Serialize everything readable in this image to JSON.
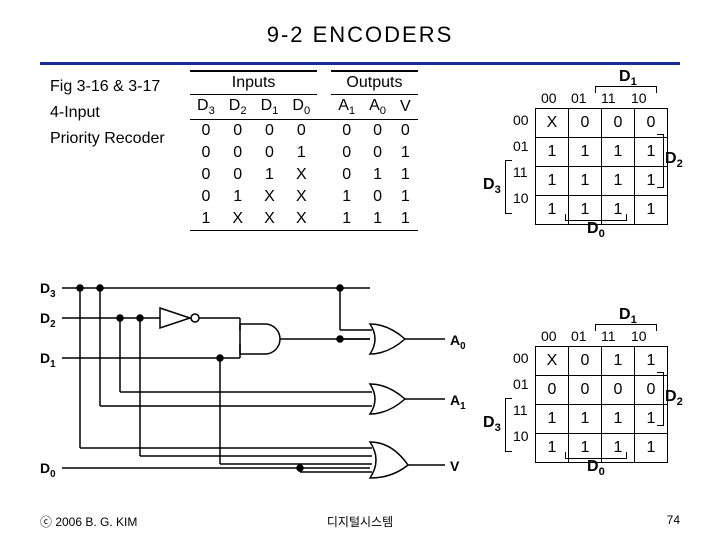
{
  "title": "9-2  ENCODERS",
  "caption": {
    "line1": "Fig 3-16 & 3-17",
    "line2": "4-Input",
    "line3": "Priority Recoder"
  },
  "truth_table": {
    "group_in": "Inputs",
    "group_out": "Outputs",
    "cols_in": [
      "D3",
      "D2",
      "D1",
      "D0"
    ],
    "cols_out": [
      "A1",
      "A0",
      "V"
    ],
    "col_d3": "D",
    "col_d3s": "3",
    "col_d2": "D",
    "col_d2s": "2",
    "col_d1": "D",
    "col_d1s": "1",
    "col_d0": "D",
    "col_d0s": "0",
    "col_a1": "A",
    "col_a1s": "1",
    "col_a0": "A",
    "col_a0s": "0",
    "col_v": "V",
    "rows": [
      {
        "d3": "0",
        "d2": "0",
        "d1": "0",
        "d0": "0",
        "a1": "0",
        "a0": "0",
        "v": "0"
      },
      {
        "d3": "0",
        "d2": "0",
        "d1": "0",
        "d0": "1",
        "a1": "0",
        "a0": "0",
        "v": "1"
      },
      {
        "d3": "0",
        "d2": "0",
        "d1": "1",
        "d0": "X",
        "a1": "0",
        "a0": "1",
        "v": "1"
      },
      {
        "d3": "0",
        "d2": "1",
        "d1": "X",
        "d0": "X",
        "a1": "1",
        "a0": "0",
        "v": "1"
      },
      {
        "d3": "1",
        "d2": "X",
        "d1": "X",
        "d0": "X",
        "a1": "1",
        "a0": "1",
        "v": "1"
      }
    ]
  },
  "kmap_top": {
    "col_hdr": [
      "00",
      "01",
      "11",
      "10"
    ],
    "row_hdr": [
      "00",
      "01",
      "11",
      "10"
    ],
    "label_top": "D",
    "label_top_s": "1",
    "label_right": "D",
    "label_right_s": "2",
    "label_bot": "D",
    "label_bot_s": "0",
    "label_left": "D",
    "label_left_s": "3",
    "cells": [
      [
        "X",
        "0",
        "0",
        "0"
      ],
      [
        "1",
        "1",
        "1",
        "1"
      ],
      [
        "1",
        "1",
        "1",
        "1"
      ],
      [
        "1",
        "1",
        "1",
        "1"
      ]
    ]
  },
  "kmap_bot": {
    "col_hdr": [
      "00",
      "01",
      "11",
      "10"
    ],
    "row_hdr": [
      "00",
      "01",
      "11",
      "10"
    ],
    "label_top": "D",
    "label_top_s": "1",
    "label_right": "D",
    "label_right_s": "2",
    "label_bot": "D",
    "label_bot_s": "0",
    "label_left": "D",
    "label_left_s": "3",
    "cells": [
      [
        "X",
        "0",
        "1",
        "1"
      ],
      [
        "0",
        "0",
        "0",
        "0"
      ],
      [
        "1",
        "1",
        "1",
        "1"
      ],
      [
        "1",
        "1",
        "1",
        "1"
      ]
    ]
  },
  "circuit": {
    "inputs": {
      "d3": "D",
      "d3s": "3",
      "d2": "D",
      "d2s": "2",
      "d1": "D",
      "d1s": "1",
      "d0": "D",
      "d0s": "0"
    },
    "outputs": {
      "a0": "A",
      "a0s": "0",
      "a1": "A",
      "a1s": "1",
      "v": "V"
    }
  },
  "footer": {
    "left": "ⓒ 2006  B. G. KIM",
    "center": "디지털시스템",
    "right": "74"
  }
}
